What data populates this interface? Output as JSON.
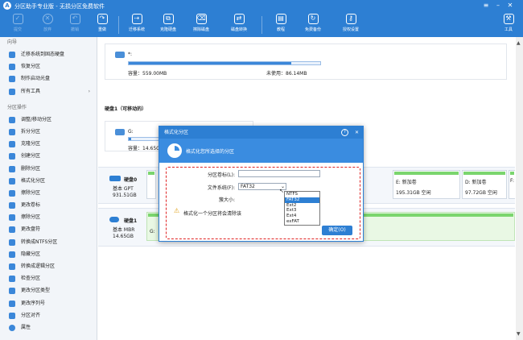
{
  "window": {
    "title": "分区助手专业版 - 无损分区免费软件",
    "logo_char": "A"
  },
  "toolbar": {
    "left": [
      {
        "label": "提交",
        "icon": "check-icon",
        "disabled": true
      },
      {
        "label": "放弃",
        "icon": "cancel-icon",
        "disabled": true
      },
      {
        "label": "撤销",
        "icon": "undo-icon",
        "disabled": true
      },
      {
        "label": "重做",
        "icon": "redo-icon",
        "disabled": false
      }
    ],
    "right": [
      {
        "label": "迁移系统",
        "icon": "migrate-icon"
      },
      {
        "label": "克隆硬盘",
        "icon": "clone-icon"
      },
      {
        "label": "擦除磁盘",
        "icon": "wipe-icon"
      },
      {
        "label": "磁盘转换",
        "icon": "convert-icon"
      },
      {
        "label": "教程",
        "icon": "book-icon"
      },
      {
        "label": "免费备份",
        "icon": "backup-icon"
      },
      {
        "label": "授权设置",
        "icon": "key-icon"
      }
    ],
    "tools": {
      "label": "工具",
      "icon": "tools-icon"
    }
  },
  "sidebar": {
    "wizard_title": "向导",
    "wizard_items": [
      {
        "label": "迁移系统到固态硬盘"
      },
      {
        "label": "恢复分区"
      },
      {
        "label": "制作启动光盘"
      },
      {
        "label": "所有工具",
        "arrow": "›"
      }
    ],
    "ops_title": "分区操作",
    "ops_items": [
      {
        "label": "调整/移动分区"
      },
      {
        "label": "拆分分区"
      },
      {
        "label": "克隆分区"
      },
      {
        "label": "创建分区"
      },
      {
        "label": "删除分区"
      },
      {
        "label": "格式化分区"
      },
      {
        "label": "擦除分区"
      },
      {
        "label": "更改卷标"
      },
      {
        "label": "擦除分区"
      },
      {
        "label": "更改盘符"
      },
      {
        "label": "转换成NTFS分区"
      },
      {
        "label": "隐藏分区"
      },
      {
        "label": "转换成逻辑分区"
      },
      {
        "label": "检查分区"
      },
      {
        "label": "更改分区类型"
      },
      {
        "label": "更改序列号"
      },
      {
        "label": "分区对齐"
      },
      {
        "label": "属性"
      }
    ]
  },
  "main": {
    "top_partition": {
      "name": "*:",
      "capacity": "容量：559.00MB",
      "unused": "未使用：86.14MB",
      "used_fraction": 0.85
    },
    "disk1_title": "硬盘1（可移动的）",
    "disk1_partition": {
      "name": "G:",
      "capacity": "容量：14.65GB",
      "used_fraction": 0.02
    },
    "disk0": {
      "name": "硬盘0",
      "type": "基本 GPT",
      "size": "931.51GB",
      "parts": [
        {
          "name": "E: 新加卷",
          "size": "195.31GB 空闲"
        },
        {
          "name": "D: 新加卷",
          "size": "97.72GB 空闲"
        },
        {
          "name": "F:",
          "size": ""
        }
      ]
    },
    "disk1": {
      "name": "硬盘1",
      "type": "基本 MBR",
      "size": "14.65GB",
      "part_letter": "G:"
    }
  },
  "dialog": {
    "title": "格式化分区",
    "help": "?",
    "close": "✕",
    "heading": "格式化您所选择的分区",
    "volume_label": "分区卷标(L):",
    "volume_value": "",
    "fs_label": "文件系统(F):",
    "fs_value": "FAT32",
    "cluster_label": "簇大小:",
    "warning": "格式化一个分区将会清除该",
    "fs_options": [
      "NTFS",
      "FAT32",
      "Ext2",
      "Ext3",
      "Ext4",
      "exFAT"
    ],
    "fs_selected_index": 1,
    "ok": "确定(O)"
  }
}
